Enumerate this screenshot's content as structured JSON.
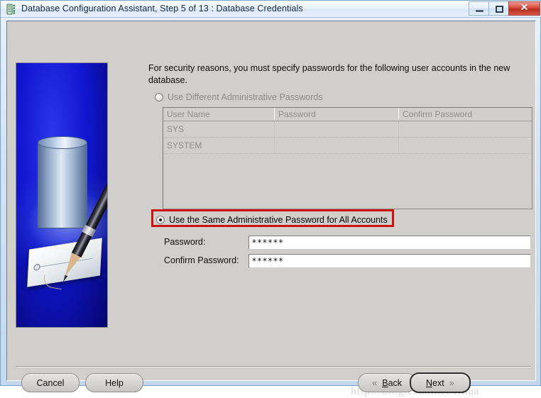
{
  "window": {
    "title": "Database Configuration Assistant, Step 5 of 13 : Database Credentials",
    "app_icon": "database-icon",
    "controls": {
      "minimize": "minimize-icon",
      "maximize": "maximize-icon",
      "close": "✕"
    }
  },
  "content": {
    "intro": "For security reasons, you must specify passwords for the following user accounts in the new database.",
    "option_different": "Use Different Administrative Passwords",
    "option_same": "Use the Same Administrative Password for All Accounts",
    "selected_option": "same"
  },
  "table": {
    "headers": [
      "User Name",
      "Password",
      "Confirm Password"
    ],
    "rows": [
      {
        "user_name": "SYS",
        "password": "",
        "confirm_password": ""
      },
      {
        "user_name": "SYSTEM",
        "password": "",
        "confirm_password": ""
      }
    ],
    "enabled": false
  },
  "fields": {
    "password_label": "Password:",
    "password_value": "******",
    "confirm_label": "Confirm Password:",
    "confirm_value": "******"
  },
  "footer": {
    "cancel": "Cancel",
    "help": "Help",
    "back": "Back",
    "back_chevron": "«",
    "next": "Next",
    "next_chevron": "»",
    "back_mnemonic": "B",
    "next_mnemonic": "N"
  },
  "annotation": {
    "color": "#cc1111",
    "target": "option_same"
  },
  "watermark": "http://blog.csdn.net/rihua",
  "colors": {
    "dialog_background": "#d0cfcb",
    "frame": "#c3d8ee",
    "sidebar_blue": "#1016cf",
    "annotation_red": "#cc1111",
    "close_red": "#d64a3c"
  }
}
